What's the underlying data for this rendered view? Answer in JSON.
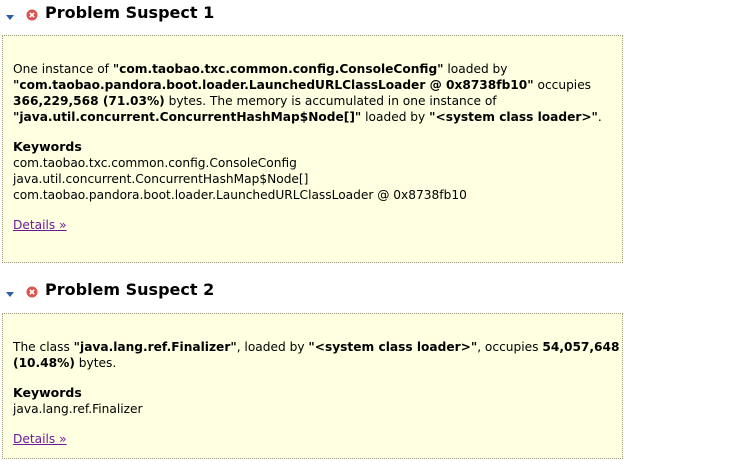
{
  "suspect1": {
    "title": "Problem Suspect 1",
    "desc": {
      "t1": "One instance of ",
      "b1": "\"com.taobao.txc.common.config.ConsoleConfig\"",
      "t2": " loaded by ",
      "b2": "\"com.taobao.pandora.boot.loader.LaunchedURLClassLoader @ 0x8738fb10\"",
      "t3": " occupies ",
      "b3": "366,229,568 (71.03%)",
      "t4": " bytes. The memory is accumulated in one instance of ",
      "b4": "\"java.util.concurrent.ConcurrentHashMap$Node[]\"",
      "t5": " loaded by ",
      "b5": "\"<system class loader>\"",
      "t6": "."
    },
    "keywords_heading": "Keywords",
    "keywords": [
      "com.taobao.txc.common.config.ConsoleConfig",
      "java.util.concurrent.ConcurrentHashMap$Node[]",
      "com.taobao.pandora.boot.loader.LaunchedURLClassLoader @ 0x8738fb10"
    ],
    "details_label": "Details »"
  },
  "suspect2": {
    "title": "Problem Suspect 2",
    "desc": {
      "t1": "The class ",
      "b1": "\"java.lang.ref.Finalizer\"",
      "t2": ", loaded by ",
      "b2": "\"<system class loader>\"",
      "t3": ", occupies ",
      "b3": "54,057,648 (10.48%)",
      "t4": " bytes."
    },
    "keywords_heading": "Keywords",
    "keywords": [
      "java.lang.ref.Finalizer"
    ],
    "details_label": "Details »"
  },
  "colors": {
    "box_background": "#ffffe1",
    "box_border": "#9c9c7a",
    "error_icon": "#d9534f",
    "toggle_arrow": "#2a5ea8",
    "link": "#6a1b9a"
  },
  "icons": {
    "toggle": "chevron-down-icon",
    "status": "error-icon"
  }
}
